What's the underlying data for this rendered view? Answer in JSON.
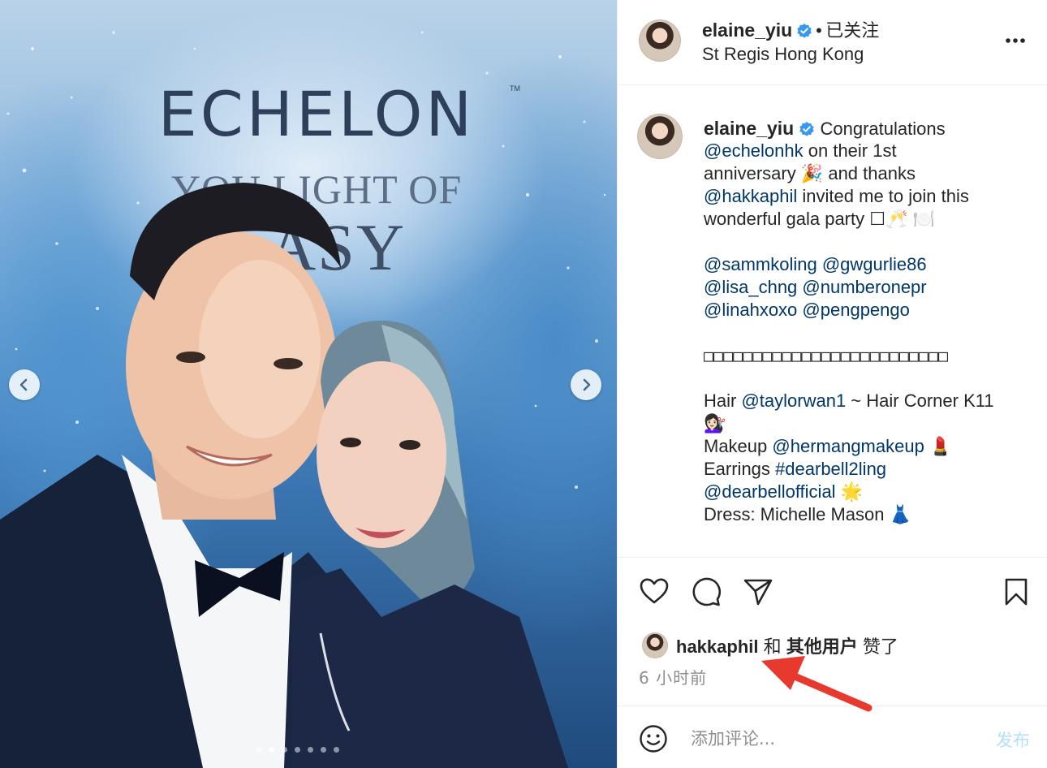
{
  "photo": {
    "brand": "ECHELON",
    "brand_tm": "TM",
    "slogan_line1": "YOU LIGHT OF",
    "slogan_line2": "ASY",
    "carousel": {
      "total": 7,
      "active": 1
    }
  },
  "header": {
    "username": "elaine_yiu",
    "separator": "•",
    "follow_status": "已关注",
    "location": "St Regis Hong Kong",
    "more_icon": "more-horizontal-icon"
  },
  "caption": {
    "username": "elaine_yiu",
    "l1_text": "Congratulations",
    "l2_mention": "@echelonhk",
    "l2_text": " on their 1st",
    "l3_text": "anniversary 🎉  and thanks",
    "l4_mention": "@hakkaphil",
    "l4_text": " invited me to join this",
    "l5_text": "wonderful gala party ☐🥂 🍽️",
    "tags_row1": [
      "@sammkoling",
      "@gwgurlie86"
    ],
    "tags_row2": [
      "@lisa_chng",
      "@numberonepr"
    ],
    "tags_row3": [
      "@linahxoxo",
      "@pengpengo"
    ],
    "boxes": "□□□□□□□□□□□□□□□□□□□□□□□□□",
    "hair_label": "Hair ",
    "hair_mention": "@taylorwan1",
    "hair_text": " ~ Hair Corner K11",
    "hair_emoji": "💇🏻‍♀️",
    "makeup_label": "Makeup ",
    "makeup_mention": "@hermangmakeup",
    "makeup_emoji": " 💄",
    "earrings_label": "Earrings ",
    "earrings_tag": "#dearbell2ling",
    "earrings_mention": "@dearbellofficial",
    "earrings_emoji": " 🌟",
    "dress_text": "Dress: Michelle Mason 👗"
  },
  "actions": {
    "like_icon": "heart-icon",
    "comment_icon": "comment-icon",
    "share_icon": "send-icon",
    "save_icon": "bookmark-icon",
    "liked_by_user": "hakkaphil",
    "liked_by_and": "和",
    "liked_by_others": "其他用户",
    "liked_by_suffix": "赞了",
    "timestamp": "6 小时前"
  },
  "comment": {
    "emoji_icon": "smiley-icon",
    "placeholder": "添加评论...",
    "post_label": "发布"
  },
  "colors": {
    "link": "#00376b",
    "verified": "#3897f0",
    "annotation_arrow": "#e8392f",
    "post_button": "#b2dffc"
  }
}
